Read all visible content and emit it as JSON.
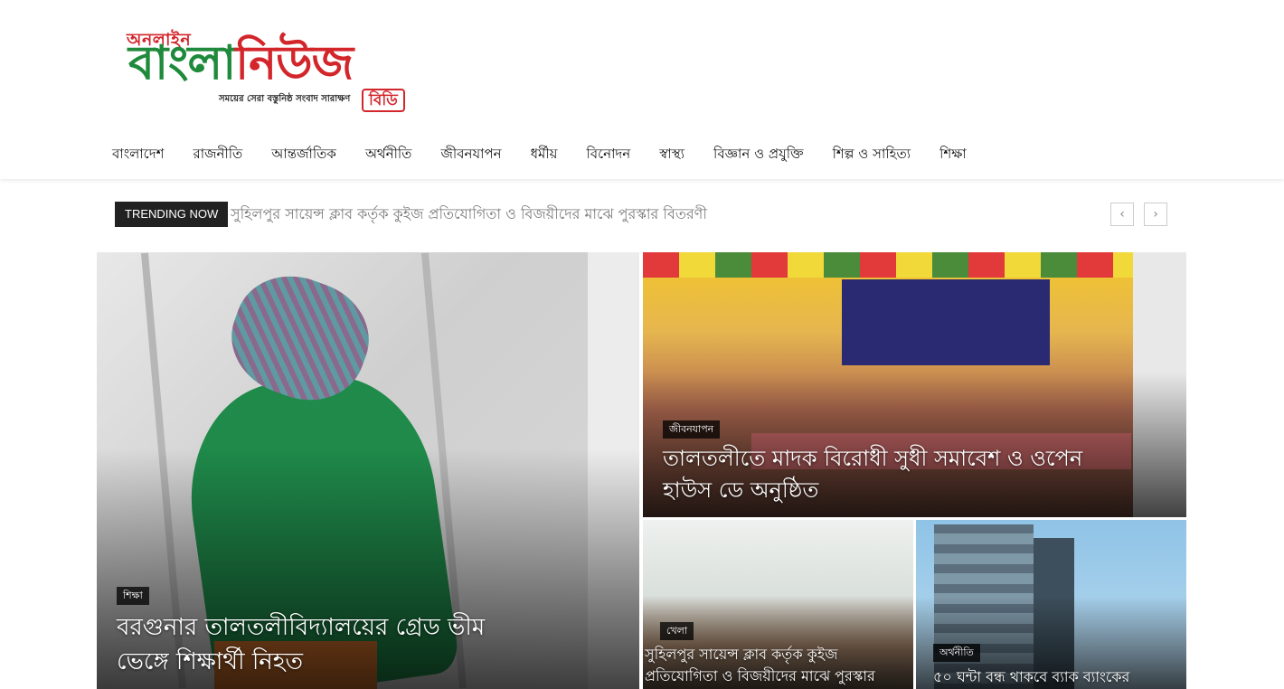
{
  "logo": {
    "top": "অনলাইন",
    "main_green": "বাংলা",
    "main_red": "নিউজ",
    "tagline": "সময়ের সেরা বস্তুনিষ্ঠ সংবাদ সারাক্ষণ",
    "badge": "বিডি"
  },
  "nav": [
    "বাংলাদেশ",
    "রাজনীতি",
    "আন্তর্জাতিক",
    "অর্থনীতি",
    "জীবনযাপন",
    "ধর্মীয়",
    "বিনোদন",
    "স্বাস্থ্য",
    "বিজ্ঞান ও প্রযুক্তি",
    "শিল্প ও সাহিত্য",
    "শিক্ষা"
  ],
  "trending": {
    "label": "TRENDING NOW",
    "text": "সুহিলপুর সায়েন্স ক্লাব কর্তৃক কুইজ প্রতিযোগিতা ও বিজয়ীদের মাঝে পুরস্কার বিতরণী",
    "prev": "‹",
    "next": "›"
  },
  "cards": [
    {
      "category": "শিক্ষা",
      "title": "বরগুনার তালতলীবিদ্যালয়ের গ্রেড ভীম ভেঙ্গে শিক্ষার্থী নিহত"
    },
    {
      "category": "জীবনযাপন",
      "title": "তালতলীতে মাদক বিরোধী সুধী সমাবেশ ও ওপেন হাউস ডে অনুষ্ঠিত"
    },
    {
      "category": "খেলা",
      "title": "সুহিলপুর সায়েন্স ক্লাব কর্তৃক কুইজ প্রতিযোগিতা ও বিজয়ীদের মাঝে পুরস্কার"
    },
    {
      "category": "অর্থনীতি",
      "title": "৫০ ঘন্টা বন্ধ থাকবে ব্যাক ব্যাংকের"
    }
  ]
}
